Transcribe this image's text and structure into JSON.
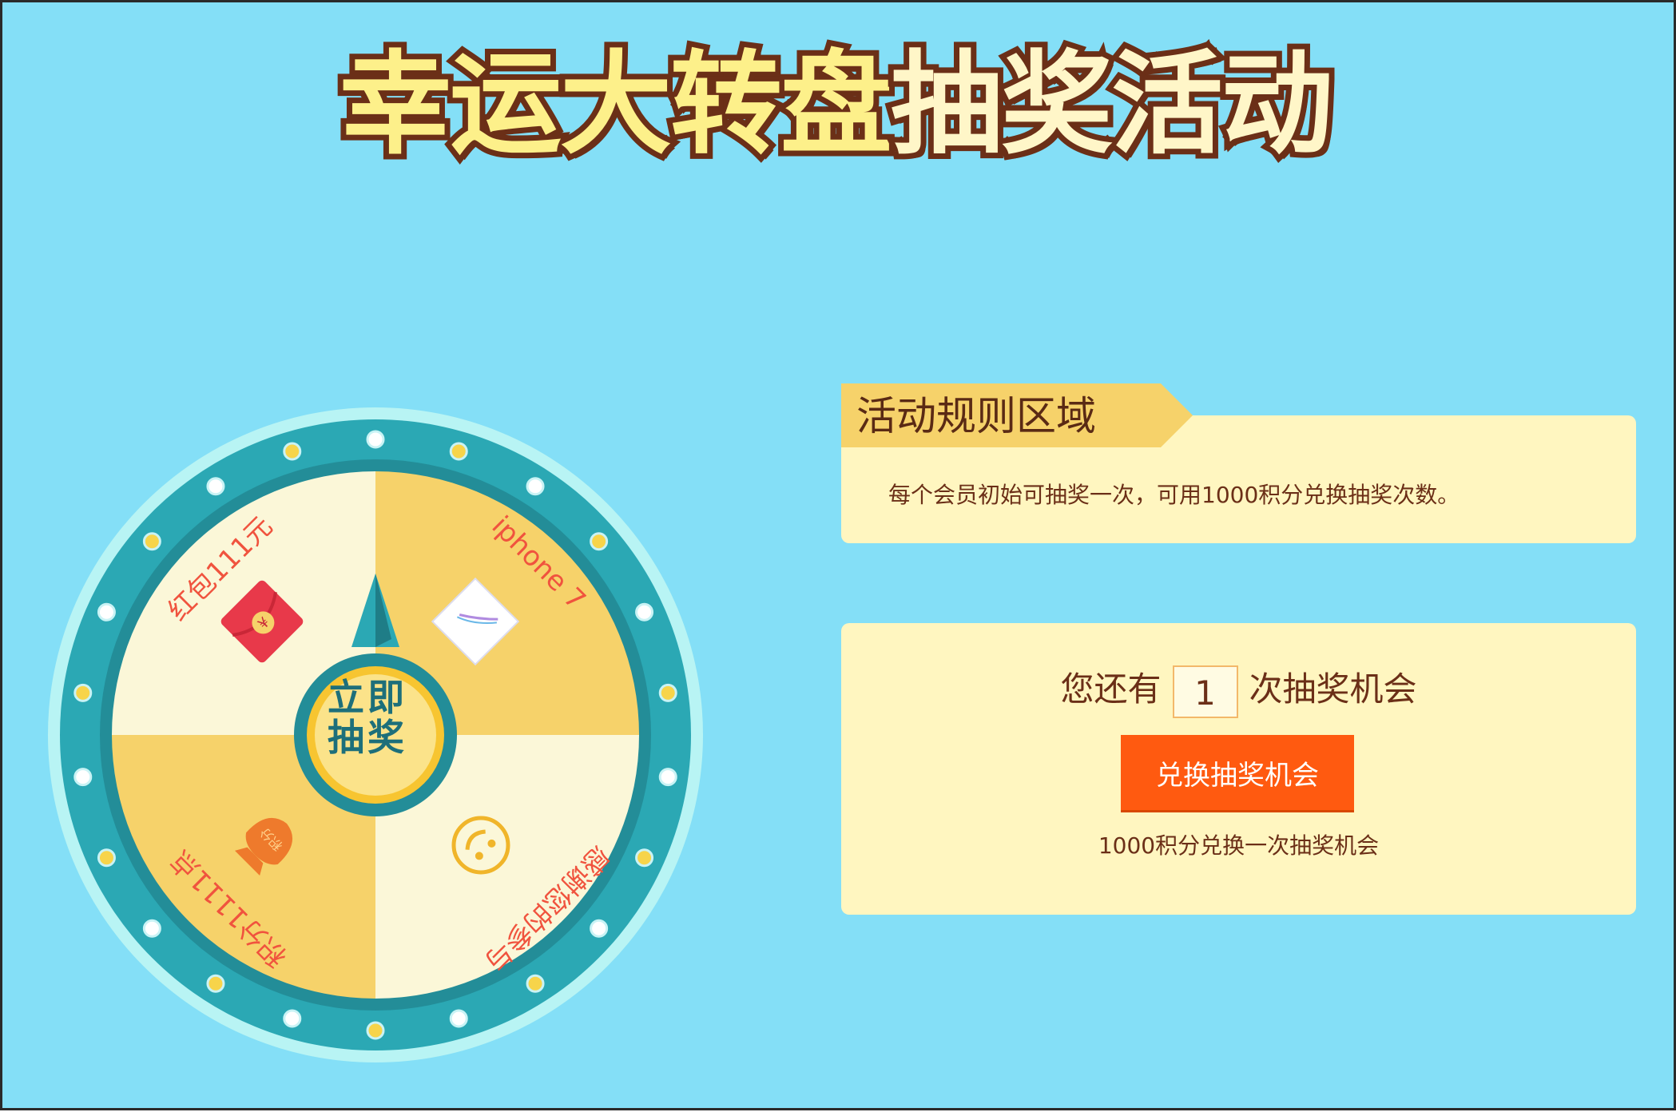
{
  "title": {
    "part1": "幸运大转盘",
    "part2": "抽奖活动"
  },
  "wheel": {
    "segments": [
      {
        "label": "红包111元",
        "icon": "red-envelope-icon"
      },
      {
        "label": "iphone 7",
        "icon": "iphone-icon"
      },
      {
        "label": "积分1111点",
        "icon": "points-bag-icon"
      },
      {
        "label": "感谢您的参与",
        "icon": "smiley-icon"
      }
    ],
    "button": {
      "line1": "立即",
      "line2": "抽奖"
    }
  },
  "rules": {
    "heading": "活动规则区域",
    "text": "每个会员初始可抽奖一次，可用1000积分兑换抽奖次数。"
  },
  "chance": {
    "prefix": "您还有",
    "count": "1",
    "suffix": "次抽奖机会",
    "exchange_button": "兑换抽奖机会",
    "note": "1000积分兑换一次抽奖机会"
  },
  "colors": {
    "background": "#84dff7",
    "wheel_ring": "#2ba8b4",
    "segment_yellow": "#f6d26a",
    "segment_cream": "#fbf7d8",
    "button_orange": "#ff5a10",
    "card": "#fff6c0"
  }
}
